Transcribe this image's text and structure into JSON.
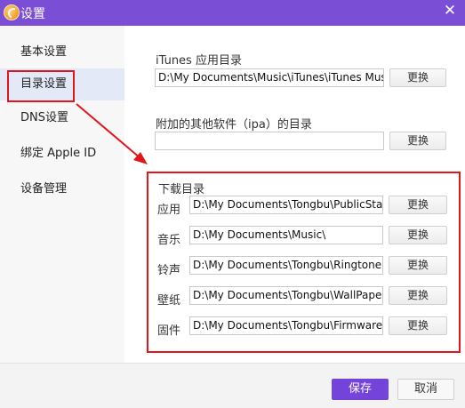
{
  "window": {
    "title": "设置",
    "close_glyph": "✕"
  },
  "sidebar": {
    "items": [
      {
        "label": "基本设置"
      },
      {
        "label": "目录设置"
      },
      {
        "label": "DNS设置"
      },
      {
        "label": "绑定 Apple ID"
      },
      {
        "label": "设备管理"
      }
    ],
    "active_index": 1
  },
  "itunes": {
    "label": "iTunes 应用目录",
    "path": "D:\\My Documents\\Music\\iTunes\\iTunes Mus",
    "button": "更换"
  },
  "ipa": {
    "label": "附加的其他软件（ipa）的目录",
    "path": "",
    "button": "更换"
  },
  "downloads": {
    "heading": "下载目录",
    "rows": [
      {
        "label": "应用",
        "path": "D:\\My Documents\\Tongbu\\PublicStag",
        "button": "更换"
      },
      {
        "label": "音乐",
        "path": "D:\\My Documents\\Music\\",
        "button": "更换"
      },
      {
        "label": "铃声",
        "path": "D:\\My Documents\\Tongbu\\Ringtone",
        "button": "更换"
      },
      {
        "label": "壁纸",
        "path": "D:\\My Documents\\Tongbu\\WallPape",
        "button": "更换"
      },
      {
        "label": "固件",
        "path": "D:\\My Documents\\Tongbu\\Firmware\\",
        "button": "更换"
      }
    ]
  },
  "footer": {
    "ok": "保存",
    "cancel": "取消"
  },
  "colors": {
    "titlebar": "#7a4fd6",
    "primary_button": "#7443d9",
    "annotation": "#e0161b",
    "sidebar_active": "#e4e9f8"
  },
  "icons": {
    "app": "tongbu-app-icon",
    "close": "close-icon"
  }
}
